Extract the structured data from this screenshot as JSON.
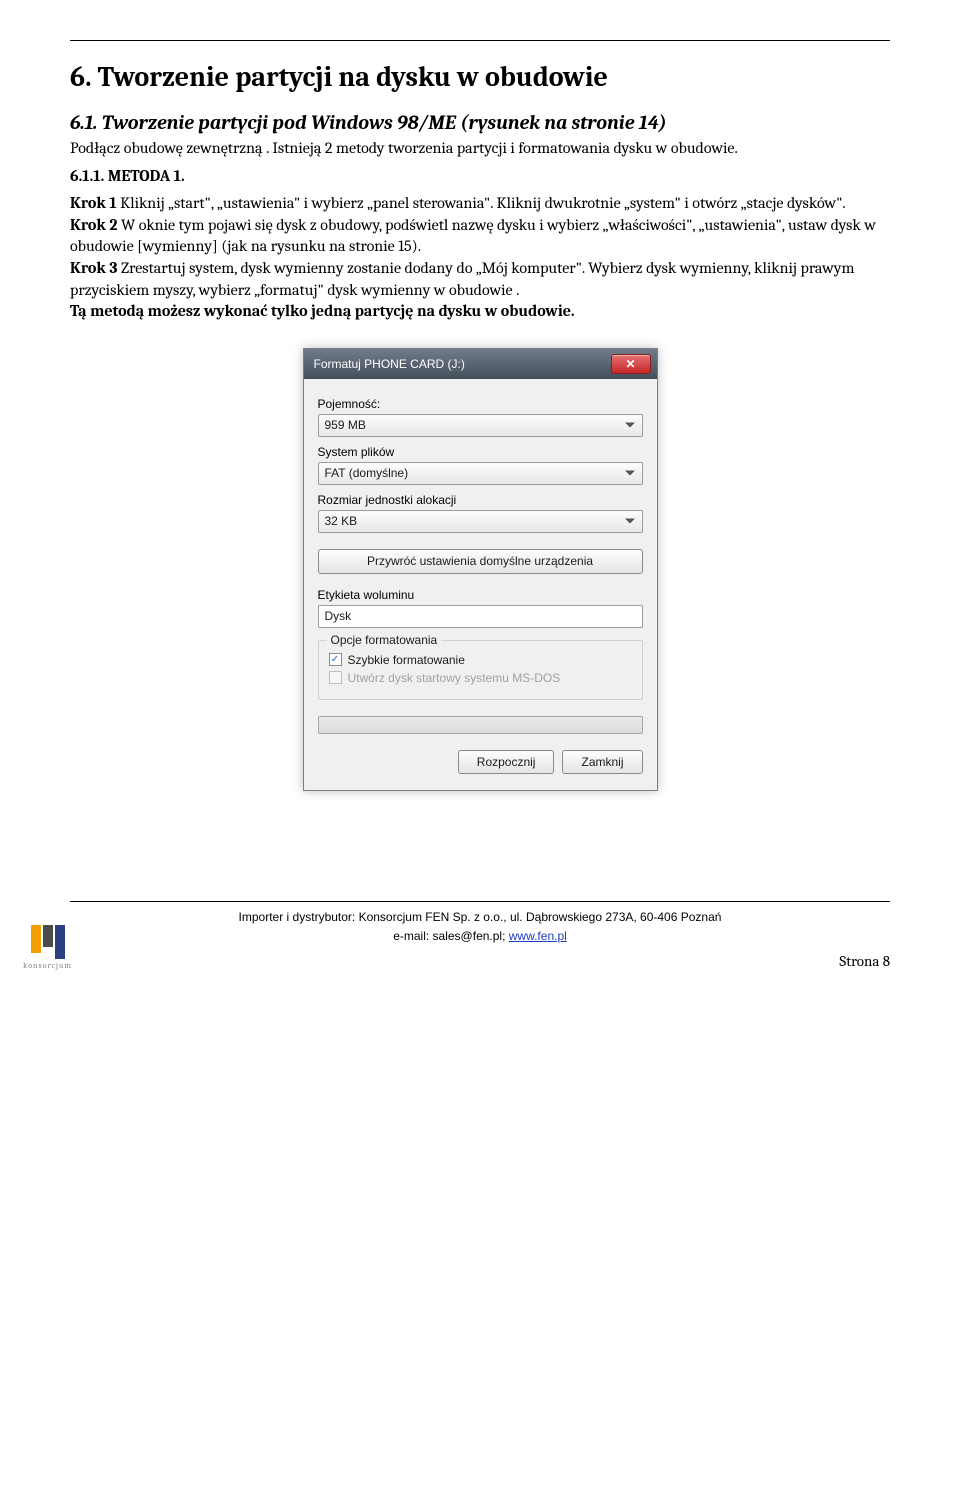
{
  "section": {
    "title": "6. Tworzenie partycji na dysku w obudowie",
    "subtitle": "6.1. Tworzenie partycji pod Windows 98/ME (rysunek na stronie 14)",
    "intro": "Podłącz obudowę zewnętrzną . Istnieją 2 metody tworzenia partycji i formatowania dysku w obudowie.",
    "metoda": "6.1.1.  METODA 1.",
    "krok1_label": "Krok 1",
    "krok1": " Kliknij „start\", „ustawienia\" i wybierz „panel sterowania\". Kliknij dwukrotnie „system\" i otwórz „stacje dysków\".",
    "krok2_label": "Krok 2",
    "krok2": " W oknie tym pojawi się dysk z obudowy, podświetl nazwę dysku i wybierz „właściwości\", „ustawienia\", ustaw dysk w obudowie [wymienny] (jak na rysunku na stronie 15).",
    "krok3_label": "Krok 3",
    "krok3": " Zrestartuj system, dysk wymienny zostanie dodany do „Mój komputer\". Wybierz dysk wymienny, kliknij prawym przyciskiem myszy, wybierz „formatuj\" dysk wymienny w obudowie .",
    "note": "Tą metodą możesz wykonać tylko jedną partycję na dysku w obudowie."
  },
  "dialog": {
    "title": "Formatuj PHONE CARD (J:)",
    "labels": {
      "capacity": "Pojemność:",
      "filesystem": "System plików",
      "alloc": "Rozmiar jednostki alokacji",
      "volume": "Etykieta woluminu",
      "options": "Opcje formatowania"
    },
    "values": {
      "capacity": "959 MB",
      "filesystem": "FAT (domyślne)",
      "alloc": "32 KB",
      "volume": "Dysk"
    },
    "buttons": {
      "restore": "Przywróć ustawienia domyślne urządzenia",
      "start": "Rozpocznij",
      "close": "Zamknij"
    },
    "checks": {
      "quick": "Szybkie formatowanie",
      "msdos": "Utwórz dysk startowy systemu MS-DOS"
    }
  },
  "footer": {
    "line1": "Importer i dystrybutor: Konsorcjum FEN Sp. z o.o., ul. Dąbrowskiego 273A, 60-406 Poznań",
    "line2_prefix": "e-mail: sales@fen.pl; ",
    "link": "www.fen.pl",
    "page": "Strona 8",
    "logo_text": "konsorcjum"
  }
}
